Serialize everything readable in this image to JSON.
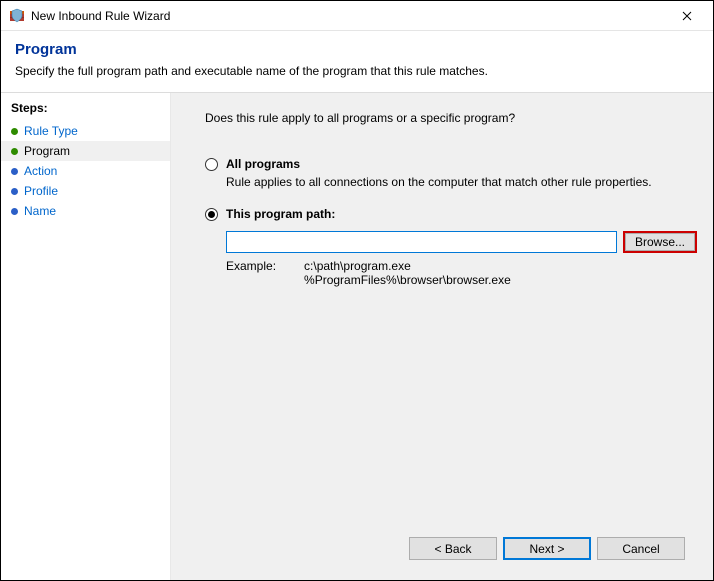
{
  "window": {
    "title": "New Inbound Rule Wizard"
  },
  "header": {
    "page_title": "Program",
    "page_desc": "Specify the full program path and executable name of the program that this rule matches."
  },
  "sidebar": {
    "steps_label": "Steps:",
    "items": [
      {
        "label": "Rule Type",
        "bullet": "green",
        "state": "link"
      },
      {
        "label": "Program",
        "bullet": "green",
        "state": "current"
      },
      {
        "label": "Action",
        "bullet": "blue",
        "state": "link"
      },
      {
        "label": "Profile",
        "bullet": "blue",
        "state": "link"
      },
      {
        "label": "Name",
        "bullet": "blue",
        "state": "link"
      }
    ]
  },
  "main": {
    "question": "Does this rule apply to all programs or a specific program?",
    "option_all": {
      "label": "All programs",
      "desc": "Rule applies to all connections on the computer that match other rule properties."
    },
    "option_path": {
      "label": "This program path:",
      "value": "",
      "browse_label": "Browse...",
      "example_label": "Example:",
      "example_lines": "c:\\path\\program.exe\n%ProgramFiles%\\browser\\browser.exe"
    }
  },
  "footer": {
    "back": "< Back",
    "next": "Next >",
    "cancel": "Cancel"
  }
}
